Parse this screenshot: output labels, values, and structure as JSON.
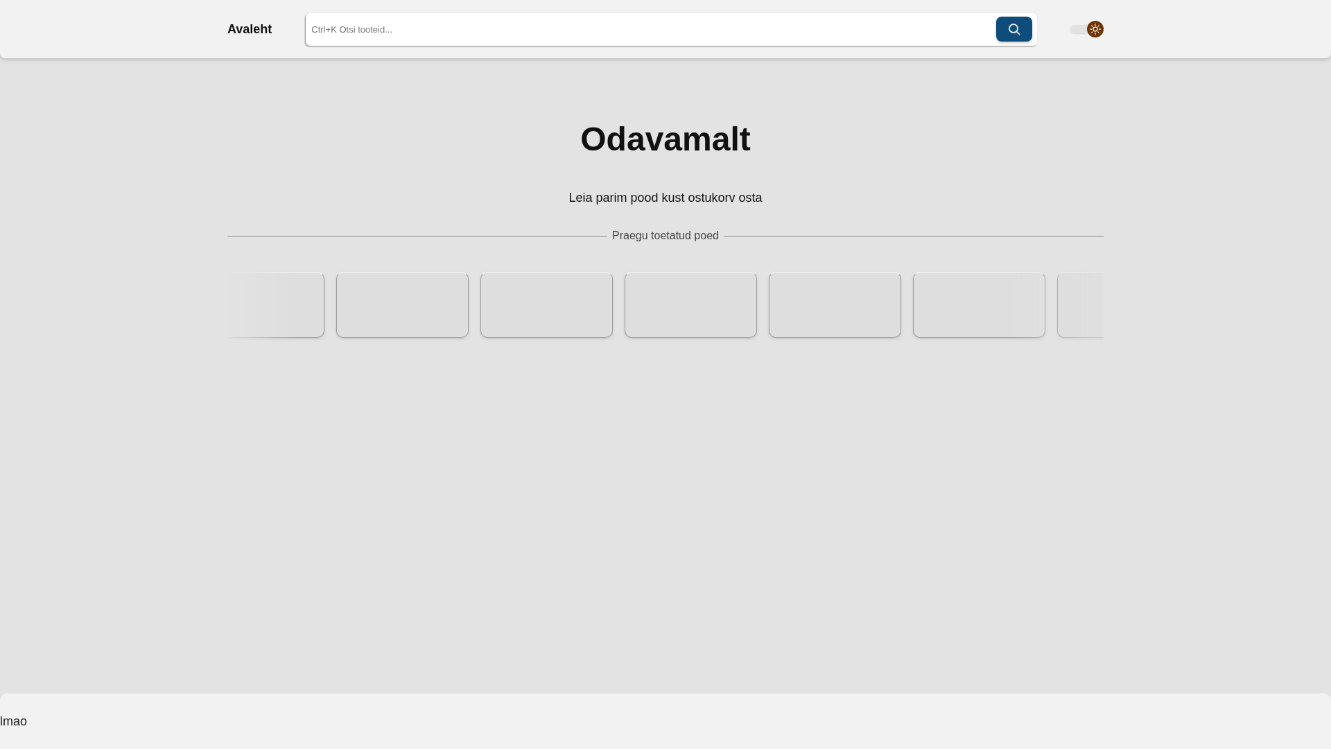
{
  "header": {
    "home_link": "Avaleht",
    "search": {
      "placeholder": "Ctrl+K Otsi tooteid..."
    },
    "theme_toggle": {
      "on": true
    }
  },
  "hero": {
    "title": "Odavamalt",
    "subtitle": "Leia parim pood kust ostukorv osta"
  },
  "stores_section": {
    "heading": "Praegu toetatud poed"
  },
  "footer": {
    "text": "lmao"
  }
}
